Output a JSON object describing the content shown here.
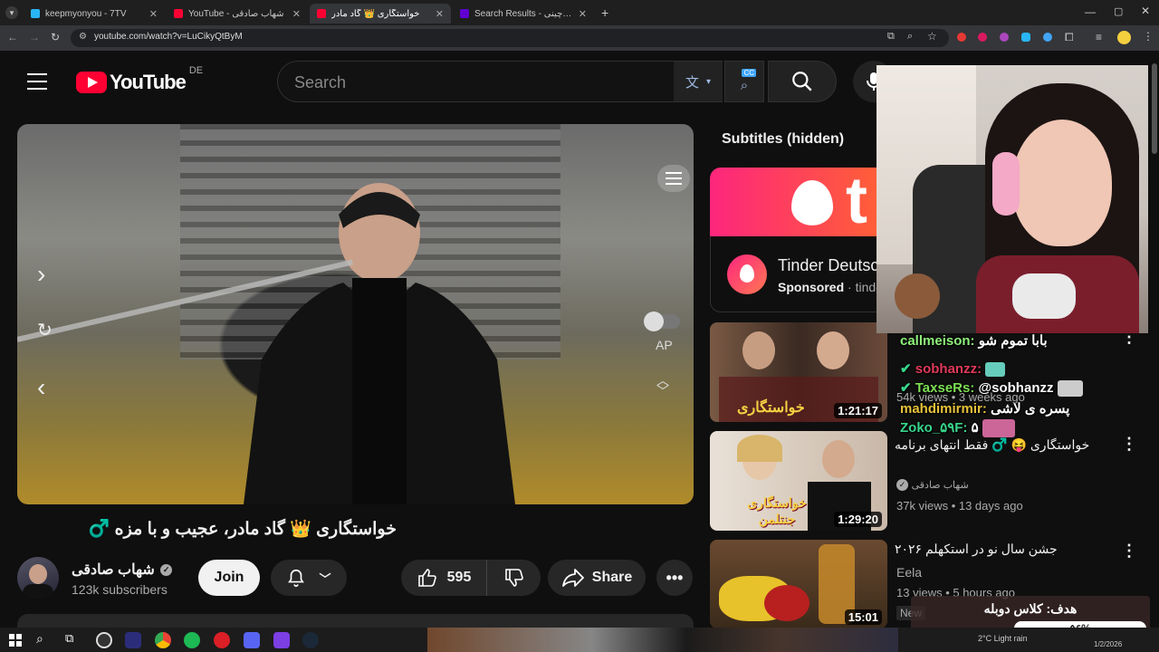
{
  "browser": {
    "tabs": [
      {
        "label": "keepmyonyou - 7TV",
        "active": false
      },
      {
        "label": "YouTube - شهاب صادقی",
        "active": false
      },
      {
        "label": "خواستگاری 👑 گاد مادر",
        "active": true
      },
      {
        "label": "Search Results - طالع بینی چینی",
        "active": false
      }
    ],
    "url": "youtube.com/watch?v=LuCikyQtByM"
  },
  "youtube": {
    "logo_text": "YouTube",
    "region": "DE",
    "search_placeholder": "Search",
    "cc_badge": "CC"
  },
  "player": {
    "ap_label": "AP"
  },
  "video": {
    "title": "خواستگاری 👑 گاد مادر، عجیب و با مزه ♂️",
    "channel_name": "شهاب صادقی",
    "subscribers": "123k subscribers",
    "join_label": "Join",
    "likes": "595",
    "share_label": "Share"
  },
  "sidebar": {
    "subtitles_hidden": "Subtitles (hidden)",
    "ad": {
      "brand_letter": "t",
      "title": "Tinder Deutsc",
      "sponsored": "Sponsored",
      "domain": "tinde"
    },
    "videos": [
      {
        "title": "",
        "duration": "1:21:17",
        "channel": "",
        "meta": "54k views • 3 weeks ago",
        "thumb_text": "خواستگاری"
      },
      {
        "title": "خواستگاری 😝 ♂️ فقط انتهای برنامه",
        "duration": "1:29:20",
        "channel": "شهاب صادقی",
        "meta": "37k views • 13 days ago",
        "thumb_text": "خواستگاری جنتلمن"
      },
      {
        "title": "جشن سال نو در استکهلم ۲۰۲۶",
        "duration": "15:01",
        "channel": "Eela",
        "meta": "13 views • 5 hours ago",
        "badge": "New"
      }
    ]
  },
  "chat": [
    {
      "user": "callmeison:",
      "msg": "بابا تموم شو",
      "color": "#8df07a"
    },
    {
      "user": "sobhanzz:",
      "msg": "",
      "color": "#e03a5a"
    },
    {
      "user": "TaxseRs:",
      "msg": "@sobhanzz",
      "color": "#7ddf54"
    },
    {
      "user": "mahdimirmir:",
      "msg": "پسره ی لاشی",
      "color": "#e8c23a"
    },
    {
      "user": "Zoko_۵۹F:",
      "msg": "۵",
      "color": "#39d68c"
    }
  ],
  "goal": {
    "label": "هدف: کلاس دوبله",
    "percent": "۵۶%",
    "fraction": 0.56
  },
  "taskbar": {
    "weather": "2°C  Light rain",
    "date": "1/2/2026"
  }
}
